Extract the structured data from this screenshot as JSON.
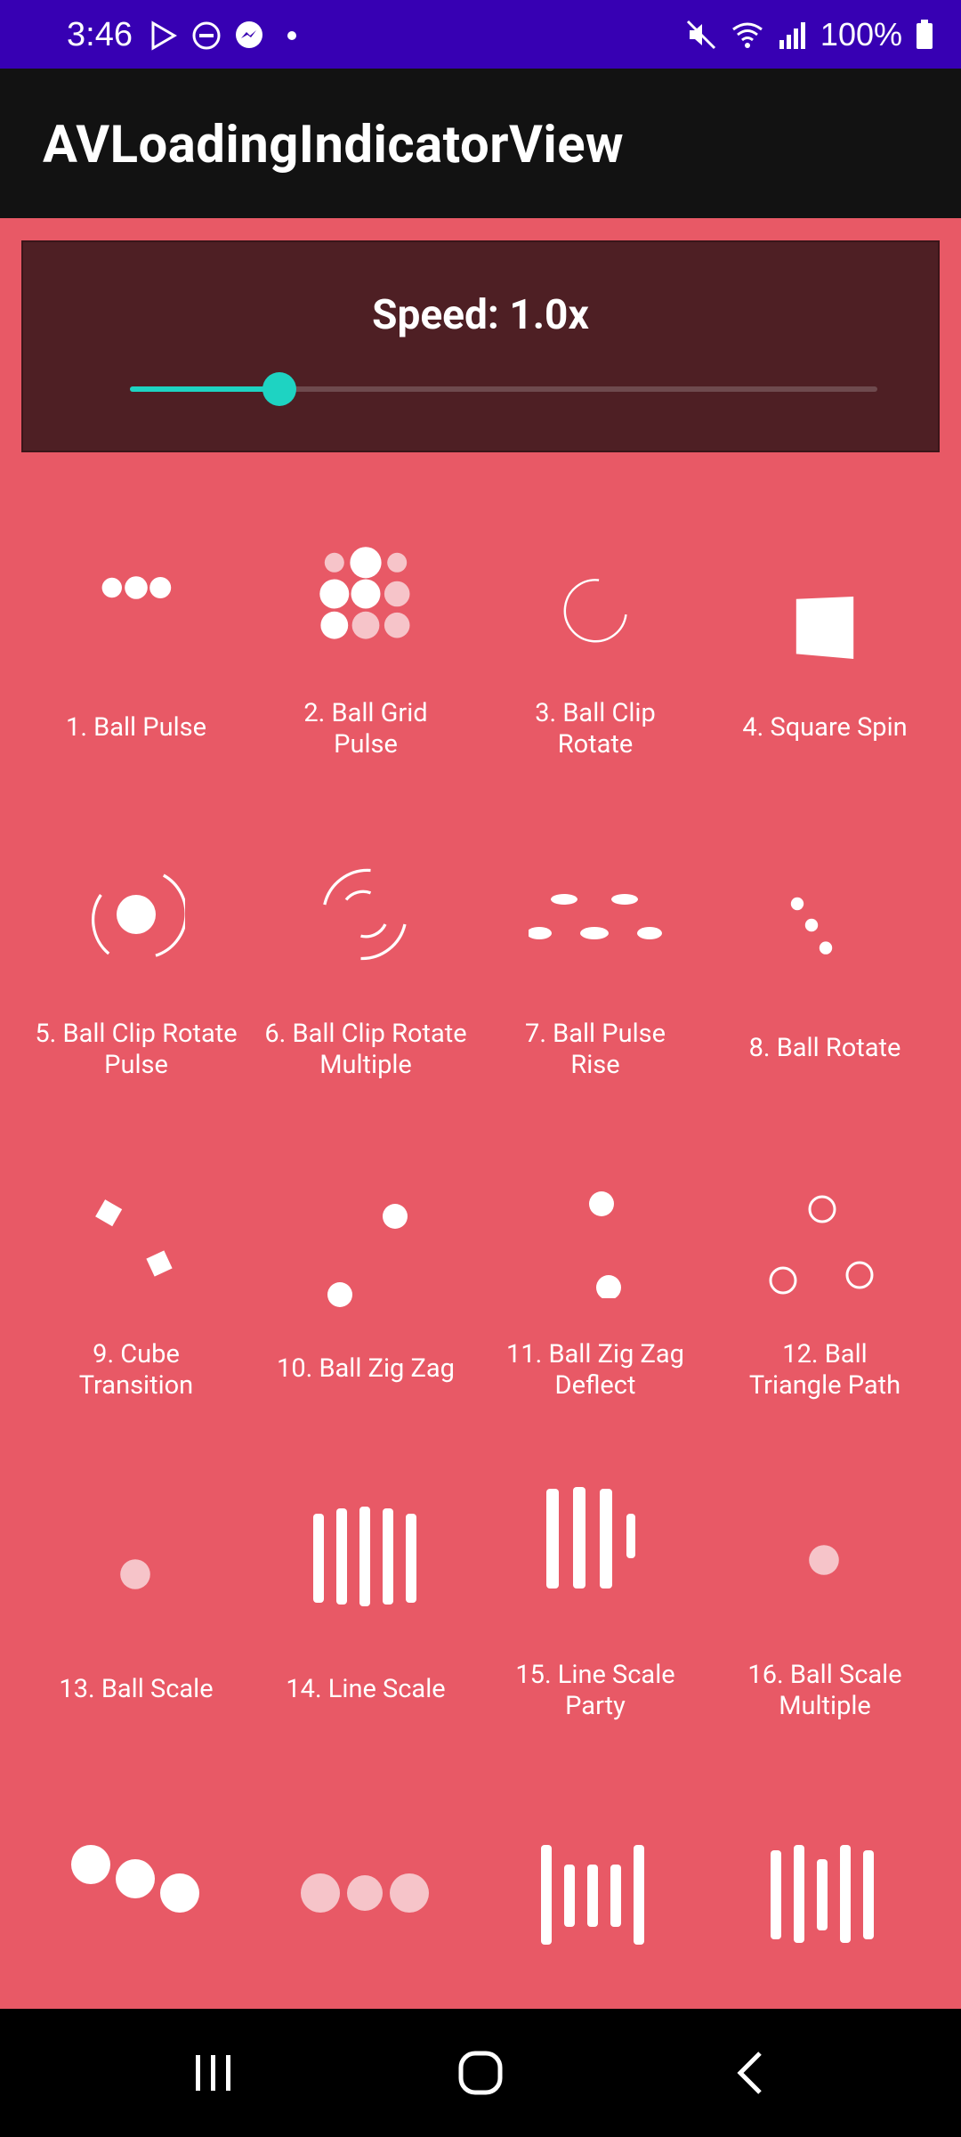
{
  "status_bar": {
    "time": "3:46",
    "battery": "100%",
    "left_icons": [
      "play-store-icon",
      "do-not-disturb-icon",
      "messenger-icon",
      "dot-icon"
    ],
    "right_icons": [
      "mute-icon",
      "wifi-icon",
      "signal-icon",
      "battery-icon"
    ]
  },
  "app_bar": {
    "title": "AVLoadingIndicatorView"
  },
  "speed": {
    "label": "Speed: 1.0x",
    "fraction": 0.2
  },
  "indicators": [
    {
      "label": "1. Ball Pulse"
    },
    {
      "label": "2. Ball Grid Pulse"
    },
    {
      "label": "3. Ball Clip Rotate"
    },
    {
      "label": "4. Square Spin"
    },
    {
      "label": "5. Ball Clip Rotate Pulse"
    },
    {
      "label": "6. Ball Clip Rotate Multiple"
    },
    {
      "label": "7. Ball Pulse Rise"
    },
    {
      "label": "8. Ball Rotate"
    },
    {
      "label": "9. Cube Transition"
    },
    {
      "label": "10. Ball Zig Zag"
    },
    {
      "label": "11. Ball Zig Zag Deflect"
    },
    {
      "label": "12. Ball Triangle Path"
    },
    {
      "label": "13. Ball Scale"
    },
    {
      "label": "14. Line Scale"
    },
    {
      "label": "15. Line Scale Party"
    },
    {
      "label": "16. Ball Scale Multiple"
    }
  ],
  "colors": {
    "status_bar": "#3700b3",
    "app_bar": "#121212",
    "background": "#e85966",
    "card": "#4e1f24",
    "accent": "#1ed3c2"
  },
  "nav": {
    "recents_icon": "recents-icon",
    "home_icon": "home-icon",
    "back_icon": "back-icon"
  }
}
